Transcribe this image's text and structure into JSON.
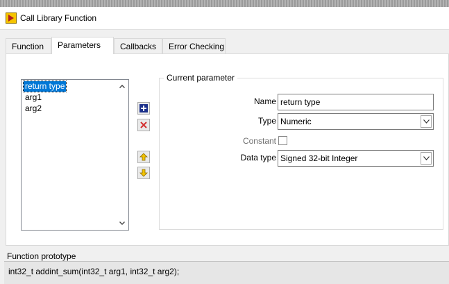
{
  "window": {
    "title": "Call Library Function",
    "icon": "labview-play-icon"
  },
  "tabs": [
    {
      "label": "Function",
      "active": false
    },
    {
      "label": "Parameters",
      "active": true
    },
    {
      "label": "Callbacks",
      "active": false
    },
    {
      "label": "Error Checking",
      "active": false
    }
  ],
  "parameters": {
    "list": [
      "return type",
      "arg1",
      "arg2"
    ],
    "selected_index": 0
  },
  "current_parameter": {
    "legend": "Current parameter",
    "name_label": "Name",
    "name_value": "return type",
    "type_label": "Type",
    "type_value": "Numeric",
    "constant_label": "Constant",
    "constant_checked": false,
    "datatype_label": "Data type",
    "datatype_value": "Signed 32-bit Integer"
  },
  "prototype": {
    "label": "Function prototype",
    "text": "int32_t addint_sum(int32_t arg1, int32_t arg2);"
  },
  "colors": {
    "selection": "#0078d7",
    "add": "#1a2f8a",
    "delete": "#d32f2f",
    "arrow": "#e0b000"
  }
}
